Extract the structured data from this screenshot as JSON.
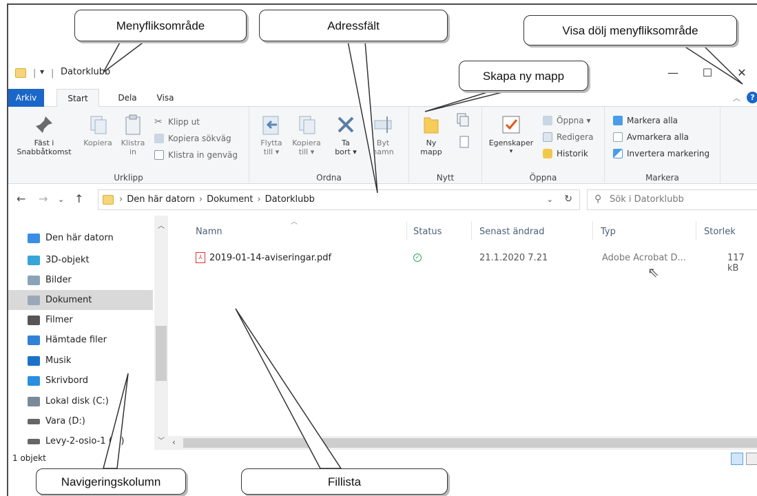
{
  "window": {
    "title": "Datorklubb",
    "qa_label": "▾"
  },
  "tabs": {
    "file": "Arkiv",
    "start": "Start",
    "share": "Dela",
    "view": "Visa"
  },
  "ribbon": {
    "urklipp": {
      "label": "Urklipp",
      "pin": "Fäst i\nSnabbåtkomst",
      "copy": "Kopiera",
      "paste": "Klistra\nin",
      "cut": "Klipp ut",
      "copy_path": "Kopiera sökväg",
      "paste_shortcut": "Klistra in genväg"
    },
    "ordna": {
      "label": "Ordna",
      "move": "Flytta\ntill ▾",
      "copy_to": "Kopiera\ntill ▾",
      "delete": "Ta\nbort ▾",
      "rename": "Byt\nnamn"
    },
    "nytt": {
      "label": "Nytt",
      "new_folder": "Ny\nmapp"
    },
    "oppna": {
      "label": "Öppna",
      "properties": "Egenskaper",
      "open": "Öppna ▾",
      "edit": "Redigera",
      "history": "Historik"
    },
    "markera": {
      "label": "Markera",
      "select_all": "Markera alla",
      "select_none": "Avmarkera alla",
      "invert": "Invertera markering"
    }
  },
  "address": {
    "crumbs": [
      "Den här datorn",
      "Dokument",
      "Datorklubb"
    ],
    "search_placeholder": "Sök i Datorklubb"
  },
  "nav": {
    "items": [
      {
        "label": "Den här datorn",
        "icon": "computer-icon",
        "color": "#3a8ee6"
      },
      {
        "label": "3D-objekt",
        "icon": "cube-icon",
        "color": "#35a4d8"
      },
      {
        "label": "Bilder",
        "icon": "pictures-icon",
        "color": "#8aa3b8"
      },
      {
        "label": "Dokument",
        "icon": "documents-icon",
        "color": "#9aa9b7",
        "selected": true
      },
      {
        "label": "Filmer",
        "icon": "film-icon",
        "color": "#555"
      },
      {
        "label": "Hämtade filer",
        "icon": "download-icon",
        "color": "#2f82d6"
      },
      {
        "label": "Musik",
        "icon": "music-icon",
        "color": "#1b73c9"
      },
      {
        "label": "Skrivbord",
        "icon": "desktop-icon",
        "color": "#2a8fe0"
      },
      {
        "label": "Lokal disk (C:)",
        "icon": "disk-icon",
        "color": "#7a8a99"
      },
      {
        "label": "Vara (D:)",
        "icon": "drive-icon",
        "color": "#666"
      },
      {
        "label": "Levy-2-osio-1 (E:)",
        "icon": "drive-icon",
        "color": "#666"
      }
    ]
  },
  "files": {
    "columns": [
      "Namn",
      "Status",
      "Senast ändrad",
      "Typ",
      "Storlek"
    ],
    "rows": [
      {
        "name": "2019-01-14-aviseringar.pdf",
        "status": "✓",
        "modified": "21.1.2020 7.21",
        "type": "Adobe Acrobat D...",
        "size": "117 kB"
      }
    ]
  },
  "statusbar": {
    "count": "1 objekt"
  },
  "callouts": {
    "ribbon_area": "Menyfliksområde",
    "address_field": "Adressfält",
    "toggle_ribbon": "Visa dölj menyfliksområde",
    "new_folder": "Skapa ny mapp",
    "nav_column": "Navigeringskolumn",
    "file_list": "Fillista"
  }
}
